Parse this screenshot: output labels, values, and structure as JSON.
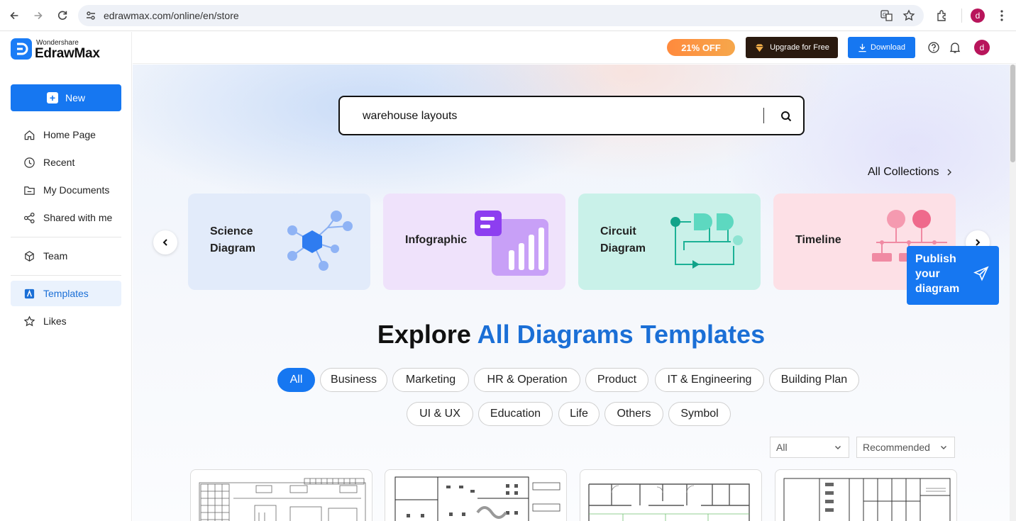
{
  "browser": {
    "url": "edrawmax.com/online/en/store",
    "avatar_letter": "d"
  },
  "sidebar": {
    "logo_small": "Wondershare",
    "logo_big": "EdrawMax",
    "new_label": "New",
    "items": [
      {
        "label": "Home Page",
        "icon": "home-icon"
      },
      {
        "label": "Recent",
        "icon": "clock-icon"
      },
      {
        "label": "My Documents",
        "icon": "folder-icon"
      },
      {
        "label": "Shared with me",
        "icon": "share-icon"
      },
      {
        "label": "Team",
        "icon": "cube-icon"
      },
      {
        "label": "Templates",
        "icon": "template-icon"
      },
      {
        "label": "Likes",
        "icon": "star-icon"
      }
    ]
  },
  "header": {
    "promo": "21% OFF",
    "upgrade_label": "Upgrade for Free",
    "download_label": "Download",
    "avatar_letter": "d"
  },
  "search": {
    "value": "warehouse layouts"
  },
  "collections": {
    "all_label": "All Collections",
    "cards": [
      {
        "label": "Science Diagram"
      },
      {
        "label": "Infographic"
      },
      {
        "label": "Circuit Diagram"
      },
      {
        "label": "Timeline"
      }
    ]
  },
  "publish": {
    "label": "Publish your diagram"
  },
  "explore": {
    "prefix": "Explore",
    "highlight": "All Diagrams Templates"
  },
  "categories": {
    "row1": [
      "All",
      "Business",
      "Marketing",
      "HR & Operation",
      "Product",
      "IT & Engineering",
      "Building Plan"
    ],
    "row2": [
      "UI & UX",
      "Education",
      "Life",
      "Others",
      "Symbol"
    ],
    "selected": "All"
  },
  "filters": {
    "type": "All",
    "sort": "Recommended"
  },
  "colors": {
    "accent": "#1677f1",
    "highlight_text": "#1b6fd6"
  }
}
